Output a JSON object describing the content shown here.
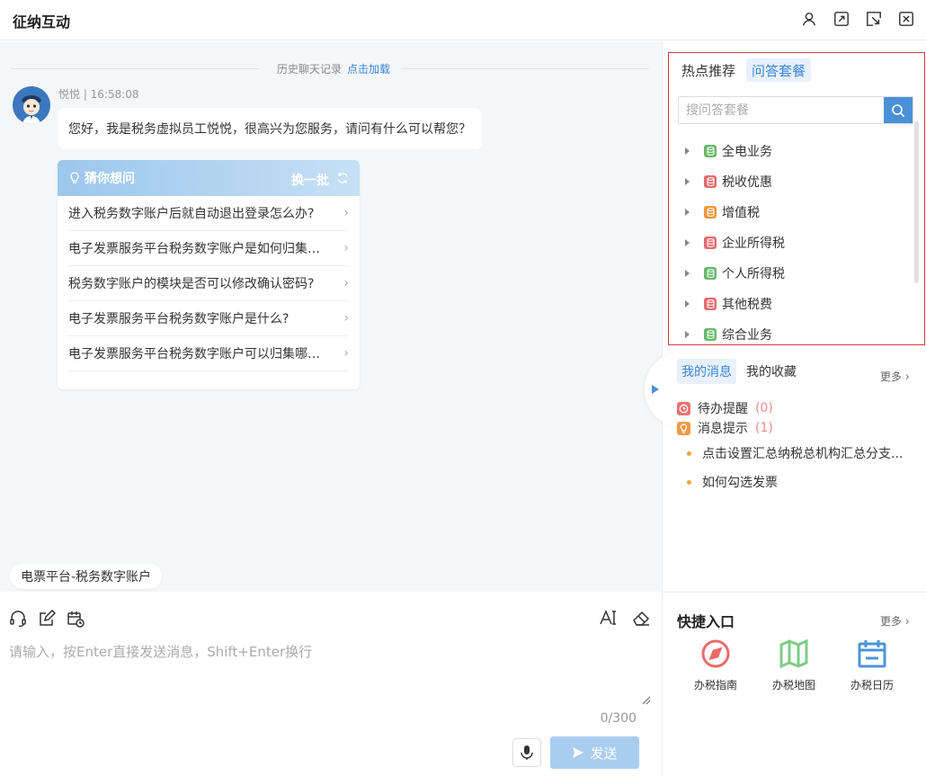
{
  "window": {
    "title": "征纳互动"
  },
  "chat": {
    "history_label": "历史聊天记录",
    "history_load": "点击加载",
    "sender_meta": "悦悦 | 16:58:08",
    "greeting": "您好，我是税务虚拟员工悦悦，很高兴为您服务，请问有什么可以帮您？",
    "guess": {
      "title": "猜你想问",
      "swap": "换一批",
      "questions": [
        "进入税务数字账户后就自动退出登录怎么办?",
        "电子发票服务平台税务数字账户是如何归集发...",
        "税务数字账户的模块是否可以修改确认密码?",
        "电子发票服务平台税务数字账户是什么?",
        "电子发票服务平台税务数字账户可以归集哪些..."
      ]
    },
    "chip": "电票平台-税务数字账户"
  },
  "input": {
    "placeholder": "请输入，按Enter直接发送消息，Shift+Enter换行",
    "counter": "0/300",
    "send_label": "发送"
  },
  "qa": {
    "tabs": [
      "热点推荐",
      "问答套餐"
    ],
    "active_tab": "问答套餐",
    "search_placeholder": "搜问答套餐",
    "items": [
      {
        "label": "全电业务",
        "color": "#67b868"
      },
      {
        "label": "税收优惠",
        "color": "#e56a6a"
      },
      {
        "label": "增值税",
        "color": "#f0943b"
      },
      {
        "label": "企业所得税",
        "color": "#e56a6a"
      },
      {
        "label": "个人所得税",
        "color": "#67b868"
      },
      {
        "label": "其他税费",
        "color": "#e56a6a"
      },
      {
        "label": "综合业务",
        "color": "#67b868"
      }
    ]
  },
  "messages": {
    "tabs": [
      "我的消息",
      "我的收藏"
    ],
    "more": "更多",
    "todo_label": "待办提醒",
    "todo_count": "(0)",
    "tip_label": "消息提示",
    "tip_count": "(1)",
    "items": [
      "点击设置汇总纳税总机构汇总分支...",
      "如何勾选发票"
    ]
  },
  "quick": {
    "title": "快捷入口",
    "more": "更多",
    "items": [
      {
        "label": "办税指南",
        "icon": "compass-icon",
        "color": "#ec6b6b"
      },
      {
        "label": "办税地图",
        "icon": "map-icon",
        "color": "#7fcb87"
      },
      {
        "label": "办税日历",
        "icon": "calendar-icon",
        "color": "#4d94d9"
      }
    ]
  }
}
